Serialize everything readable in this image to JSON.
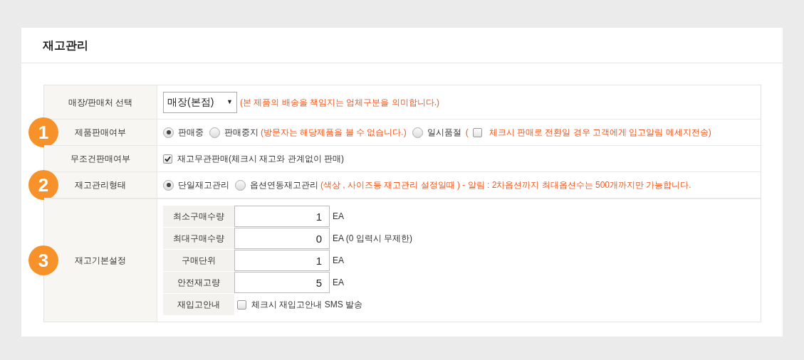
{
  "title": "재고관리",
  "rows": [
    {
      "kind": "select",
      "label": "매장/판매처 선택",
      "value": "매장(본점)",
      "caret": "▼",
      "note": "(본 제품의 배송을 책임지는 업체구분을 의미합니다.)"
    },
    {
      "kind": "radios",
      "badge": "1",
      "label": "제품판매여부",
      "options": [
        {
          "label": "판매중",
          "selected": true
        },
        {
          "label": "판매중지",
          "selected": false,
          "note": "(방문자는 해당제품을 볼 수 없습니다.)"
        },
        {
          "label": "일시품절",
          "selected": false,
          "paren": "(",
          "check": {
            "checked": false,
            "text": "체크시 판매로 전환일 경우 고객에게 입고알림 메세지전송)"
          }
        }
      ]
    },
    {
      "kind": "checkbox",
      "label": "무조건판매여부",
      "checked": true,
      "text": "재고무관판매(체크시 재고와 관계없이 판매)"
    },
    {
      "kind": "radios",
      "badge": "2",
      "label": "재고관리형태",
      "options": [
        {
          "label": "단일재고관리",
          "selected": true
        },
        {
          "label": "옵션연동재고관리",
          "selected": false,
          "note": "(색상 , 사이즈등 재고관리 설정일때 ) - 알림 : 2차옵션까지 최대옵션수는 500개까지만 가능합니다."
        }
      ]
    },
    {
      "kind": "settings",
      "badge": "3",
      "label": "재고기본설정",
      "fields": [
        {
          "kind": "number",
          "label": "최소구매수량",
          "value": "1",
          "unit": "EA"
        },
        {
          "kind": "number",
          "label": "최대구매수량",
          "value": "0",
          "unit": "EA (0 입력시 무제한)"
        },
        {
          "kind": "number",
          "label": "구매단위",
          "value": "1",
          "unit": "EA"
        },
        {
          "kind": "number",
          "label": "안전재고량",
          "value": "5",
          "unit": "EA"
        },
        {
          "kind": "checkbox",
          "label": "재입고안내",
          "checked": false,
          "text": "체크시 재입고안내 SMS 발송"
        }
      ]
    }
  ]
}
